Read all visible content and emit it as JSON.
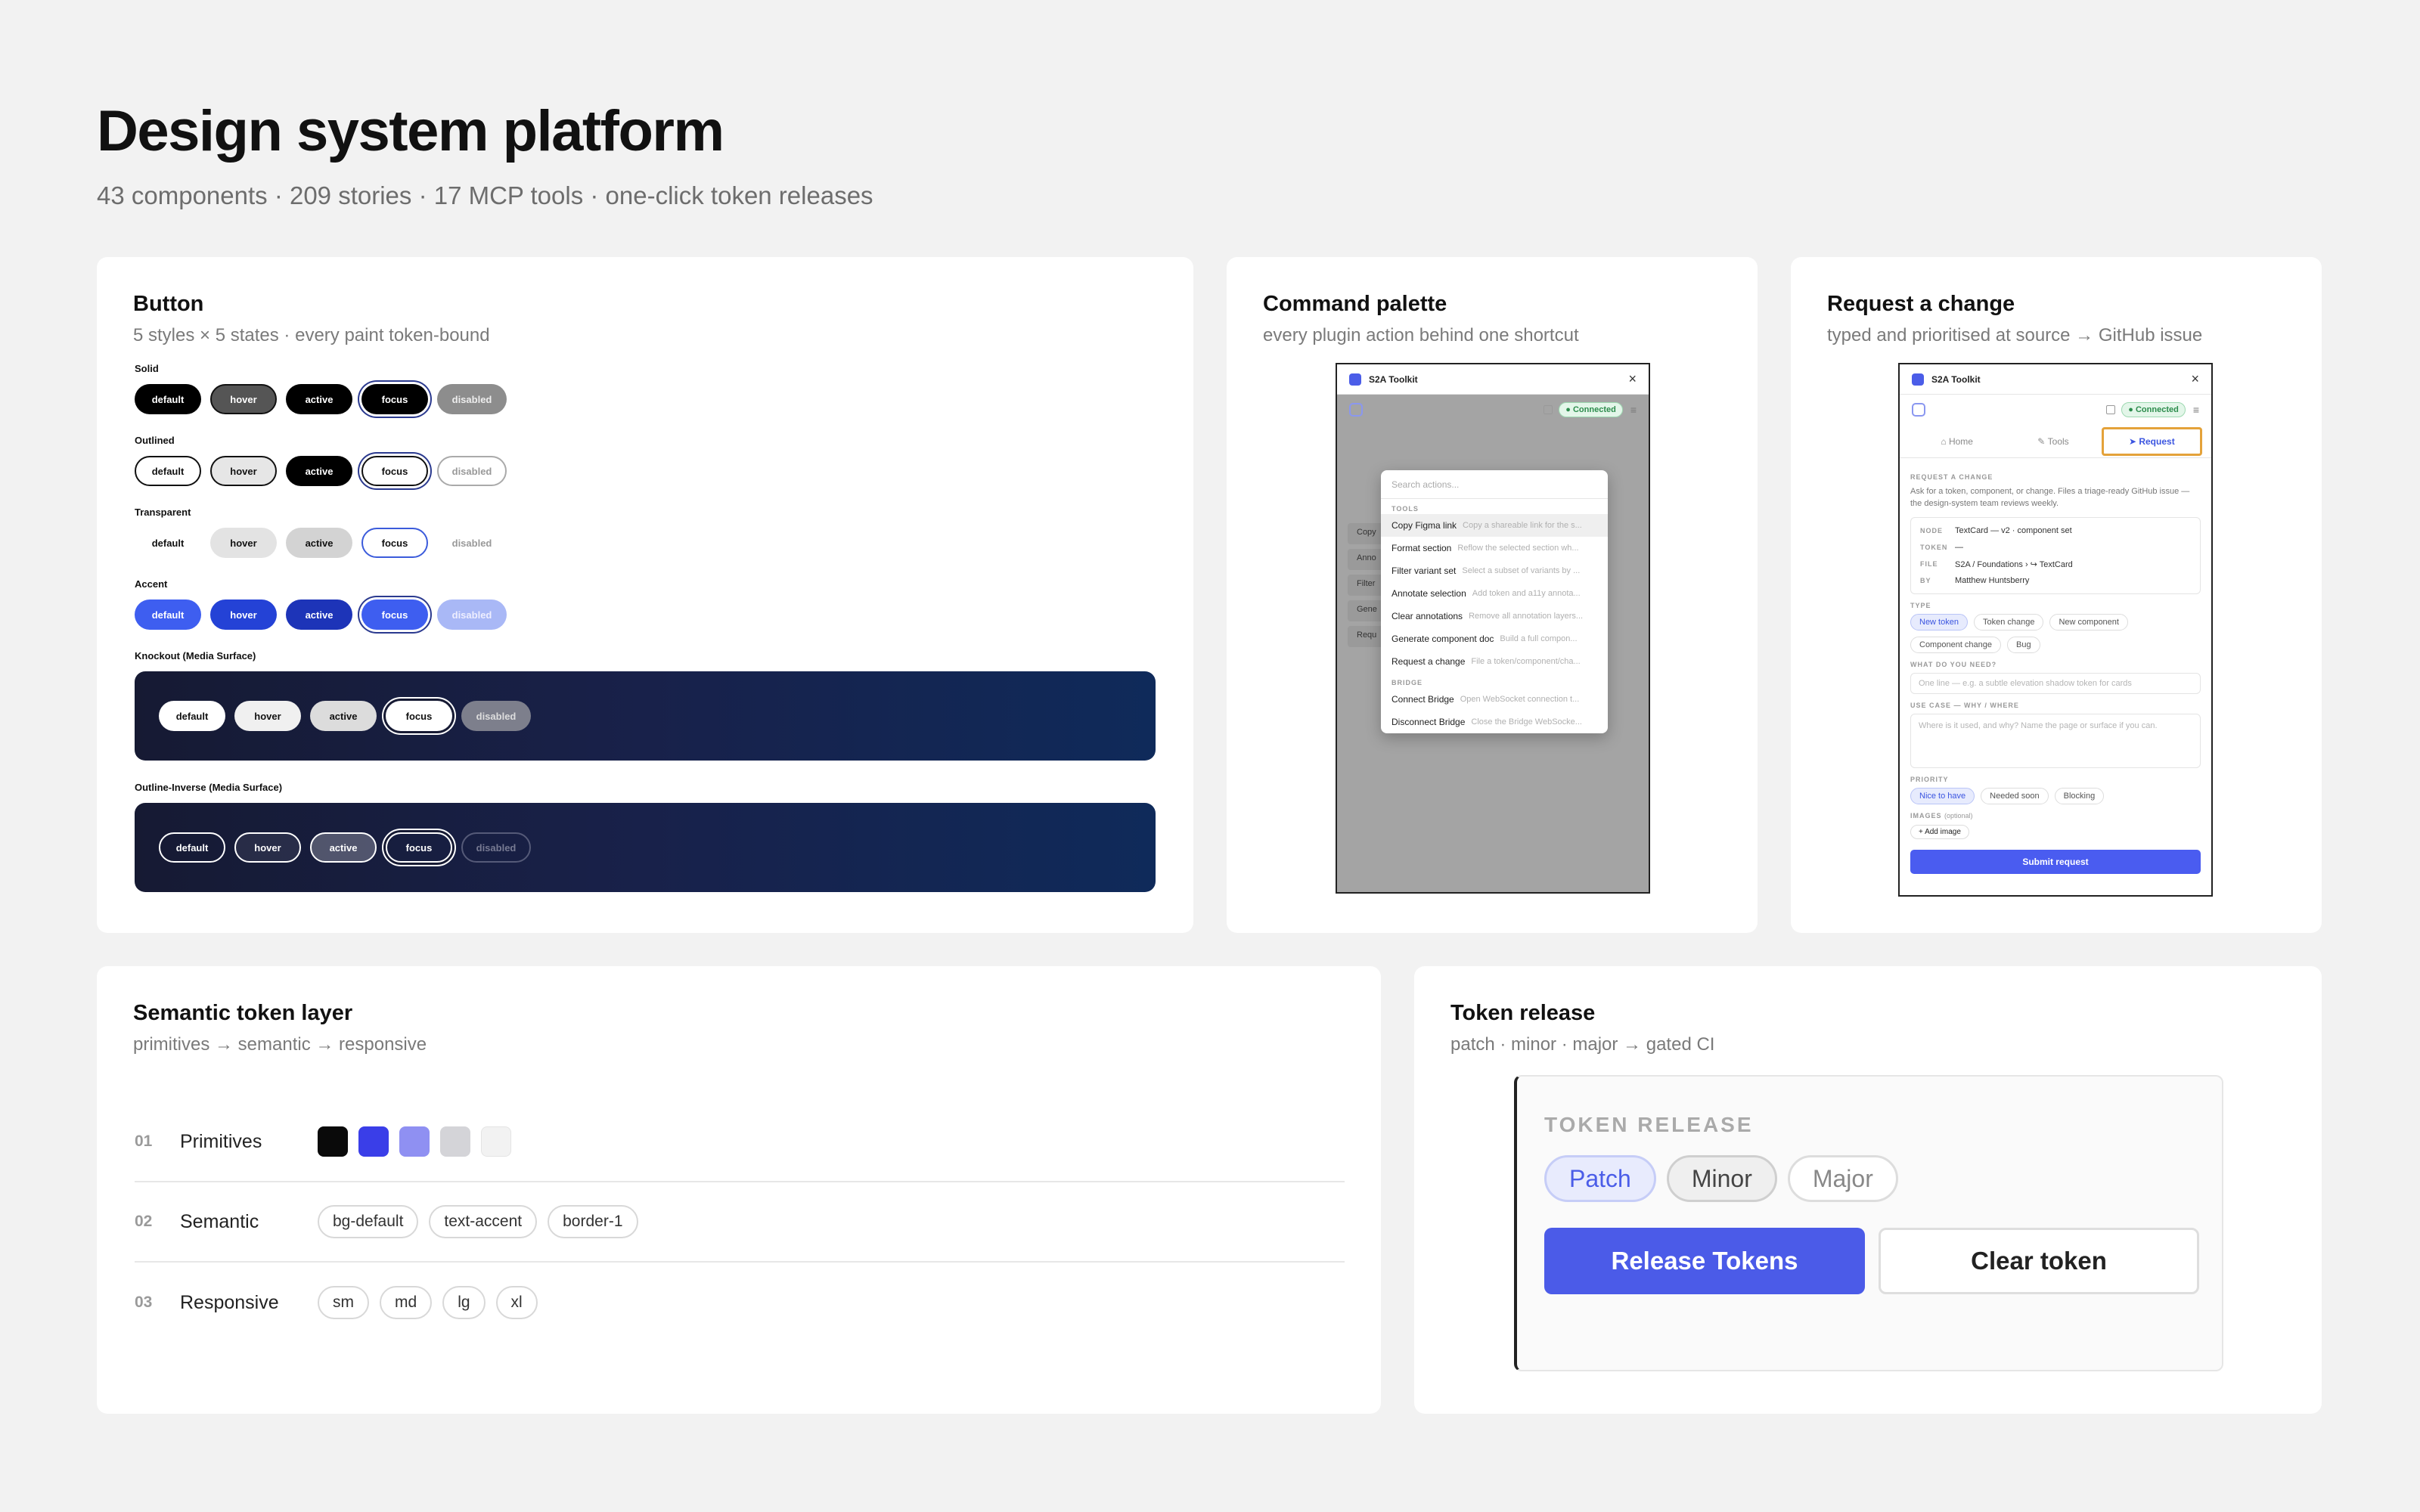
{
  "header": {
    "title": "Design system platform",
    "subtitle": "43 components · 209 stories · 17 MCP tools · one-click token releases"
  },
  "button_card": {
    "title": "Button",
    "subtitle": "5 styles × 5 states · every paint token-bound",
    "groups": [
      {
        "label": "Solid",
        "states": [
          "default",
          "hover",
          "active",
          "focus",
          "disabled"
        ]
      },
      {
        "label": "Outlined",
        "states": [
          "default",
          "hover",
          "active",
          "focus",
          "disabled"
        ]
      },
      {
        "label": "Transparent",
        "states": [
          "default",
          "hover",
          "active",
          "focus",
          "disabled"
        ]
      },
      {
        "label": "Accent",
        "states": [
          "default",
          "hover",
          "active",
          "focus",
          "disabled"
        ]
      },
      {
        "label": "Knockout (Media Surface)",
        "states": [
          "default",
          "hover",
          "active",
          "focus",
          "disabled"
        ]
      },
      {
        "label": "Outline-Inverse (Media Surface)",
        "states": [
          "default",
          "hover",
          "active",
          "focus",
          "disabled"
        ]
      }
    ]
  },
  "command_card": {
    "title": "Command palette",
    "subtitle": "every plugin action behind one shortcut",
    "plugin_name": "S2A Toolkit",
    "status": "Connected",
    "search_placeholder": "Search actions...",
    "background_rows": [
      "Copy",
      "Anno",
      "Filter",
      "Gene",
      "Requ"
    ],
    "sections": [
      {
        "label": "TOOLS",
        "items": [
          {
            "name": "Copy Figma link",
            "desc": "Copy a shareable link for the s..."
          },
          {
            "name": "Format section",
            "desc": "Reflow the selected section wh..."
          },
          {
            "name": "Filter variant set",
            "desc": "Select a subset of variants by ..."
          },
          {
            "name": "Annotate selection",
            "desc": "Add token and a11y annota..."
          },
          {
            "name": "Clear annotations",
            "desc": "Remove all annotation layers..."
          },
          {
            "name": "Generate component doc",
            "desc": "Build a full compon..."
          },
          {
            "name": "Request a change",
            "desc": "File a token/component/cha..."
          }
        ]
      },
      {
        "label": "BRIDGE",
        "items": [
          {
            "name": "Connect Bridge",
            "desc": "Open WebSocket connection t..."
          },
          {
            "name": "Disconnect Bridge",
            "desc": "Close the Bridge WebSocke..."
          }
        ]
      }
    ]
  },
  "request_card": {
    "title": "Request a change",
    "subtitle": "typed and prioritised at source → GitHub issue",
    "plugin_name": "S2A Toolkit",
    "status": "Connected",
    "tabs": [
      "Home",
      "Tools",
      "Request"
    ],
    "section_title": "REQUEST A CHANGE",
    "description": "Ask for a token, component, or change. Files a triage-ready GitHub issue — the design-system team reviews weekly.",
    "meta": [
      {
        "key": "NODE",
        "value": "TextCard — v2 · component set"
      },
      {
        "key": "TOKEN",
        "value": "—"
      },
      {
        "key": "FILE",
        "value": "S2A / Foundations › ↪ TextCard"
      },
      {
        "key": "BY",
        "value": "Matthew Huntsberry"
      }
    ],
    "type_label": "TYPE",
    "types": [
      "New token",
      "Token change",
      "New component",
      "Component change",
      "Bug"
    ],
    "need_label": "WHAT DO YOU NEED?",
    "need_placeholder": "One line — e.g. a subtle elevation shadow token for cards",
    "usecase_label": "USE CASE — WHY / WHERE",
    "usecase_placeholder": "Where is it used, and why? Name the page or surface if you can.",
    "priority_label": "PRIORITY",
    "priorities": [
      "Nice to have",
      "Needed soon",
      "Blocking"
    ],
    "images_label": "IMAGES",
    "images_optional": "(optional)",
    "add_image": "+ Add image",
    "submit": "Submit request"
  },
  "semantic_card": {
    "title": "Semantic token layer",
    "subtitle": "primitives → semantic → responsive",
    "layers": [
      {
        "num": "01",
        "name": "Primitives",
        "swatches": [
          "#0a0a0a",
          "#3a3ee8",
          "#8f90f2",
          "#d4d4d8",
          "#f2f2f2"
        ]
      },
      {
        "num": "02",
        "name": "Semantic",
        "tags": [
          "bg-default",
          "text-accent",
          "border-1"
        ]
      },
      {
        "num": "03",
        "name": "Responsive",
        "tags": [
          "sm",
          "md",
          "lg",
          "xl"
        ]
      }
    ]
  },
  "release_card": {
    "title": "Token release",
    "subtitle": "patch · minor · major → gated CI",
    "panel_label": "TOKEN RELEASE",
    "segments": [
      "Patch",
      "Minor",
      "Major"
    ],
    "primary": "Release Tokens",
    "secondary": "Clear token"
  }
}
